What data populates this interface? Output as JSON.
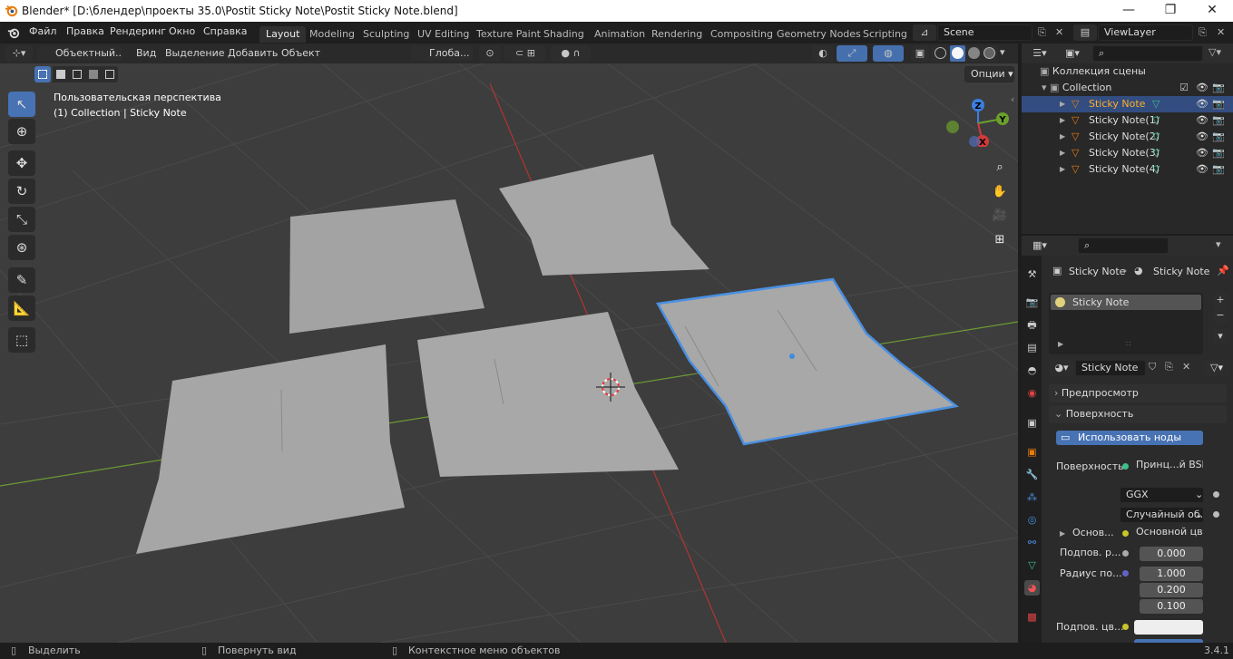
{
  "window": {
    "title": "Blender* [D:\\блендер\\проекты 35.0\\Postit Sticky Note\\Postit Sticky Note.blend]",
    "minimize": "—",
    "maximize": "❐",
    "close": "✕"
  },
  "menu": [
    "Файл",
    "Правка",
    "Рендеринг",
    "Окно",
    "Справка"
  ],
  "workspaces": [
    "Layout",
    "Modeling",
    "Sculpting",
    "UV Editing",
    "Texture Paint",
    "Shading",
    "Animation",
    "Rendering",
    "Compositing",
    "Geometry Nodes",
    "Scripting"
  ],
  "active_workspace": "Layout",
  "scene": "Scene",
  "view_layer": "ViewLayer",
  "viewport_header": {
    "mode": "Объектный...",
    "items": [
      "Вид",
      "Выделение",
      "Добавить",
      "Объект"
    ],
    "orientation": "Глоба...",
    "options": "Опции"
  },
  "viewport": {
    "perspective": "Пользовательская перспектива",
    "collection_info": "(1) Collection | Sticky Note",
    "gizmo": {
      "x": "X",
      "y": "Y",
      "z": "Z"
    }
  },
  "outliner": {
    "root": "Коллекция сцены",
    "collection": "Collection",
    "objects": [
      {
        "name": "Sticky Note",
        "selected": true
      },
      {
        "name": "Sticky Note(1)",
        "selected": false
      },
      {
        "name": "Sticky Note(2)",
        "selected": false
      },
      {
        "name": "Sticky Note(3)",
        "selected": false
      },
      {
        "name": "Sticky Note(4)",
        "selected": false
      }
    ]
  },
  "properties": {
    "breadcrumb_object": "Sticky Note",
    "breadcrumb_material": "Sticky Note",
    "material_slot": "Sticky Note",
    "material_name": "Sticky Note",
    "panel_preview": "Предпросмотр",
    "panel_surface": "Поверхность",
    "use_nodes": "Использовать ноды",
    "surface_label": "Поверхность",
    "surface_shader": "Принц...й BSDF",
    "distribution": "GGX",
    "subsurface_method": "Случайный об...",
    "base_label": "Основ...",
    "base_value": "Основной цвет",
    "subsurface_label": "Подпов. р...",
    "subsurface_value": "0.000",
    "radius_label": "Радиус по...",
    "radius": [
      "1.000",
      "0.200",
      "0.100"
    ],
    "subsurface_color_label": "Подпов. цв..."
  },
  "status": {
    "select": "Выделить",
    "rotate": "Повернуть вид",
    "context": "Контекстное меню объектов",
    "version": "3.4.1"
  },
  "colors": {
    "selection": "#4772b3",
    "outline_selected": "#4a90e2",
    "axis_x": "#d23a3a",
    "axis_y": "#6ba02c",
    "axis_z": "#3b7ee0"
  }
}
